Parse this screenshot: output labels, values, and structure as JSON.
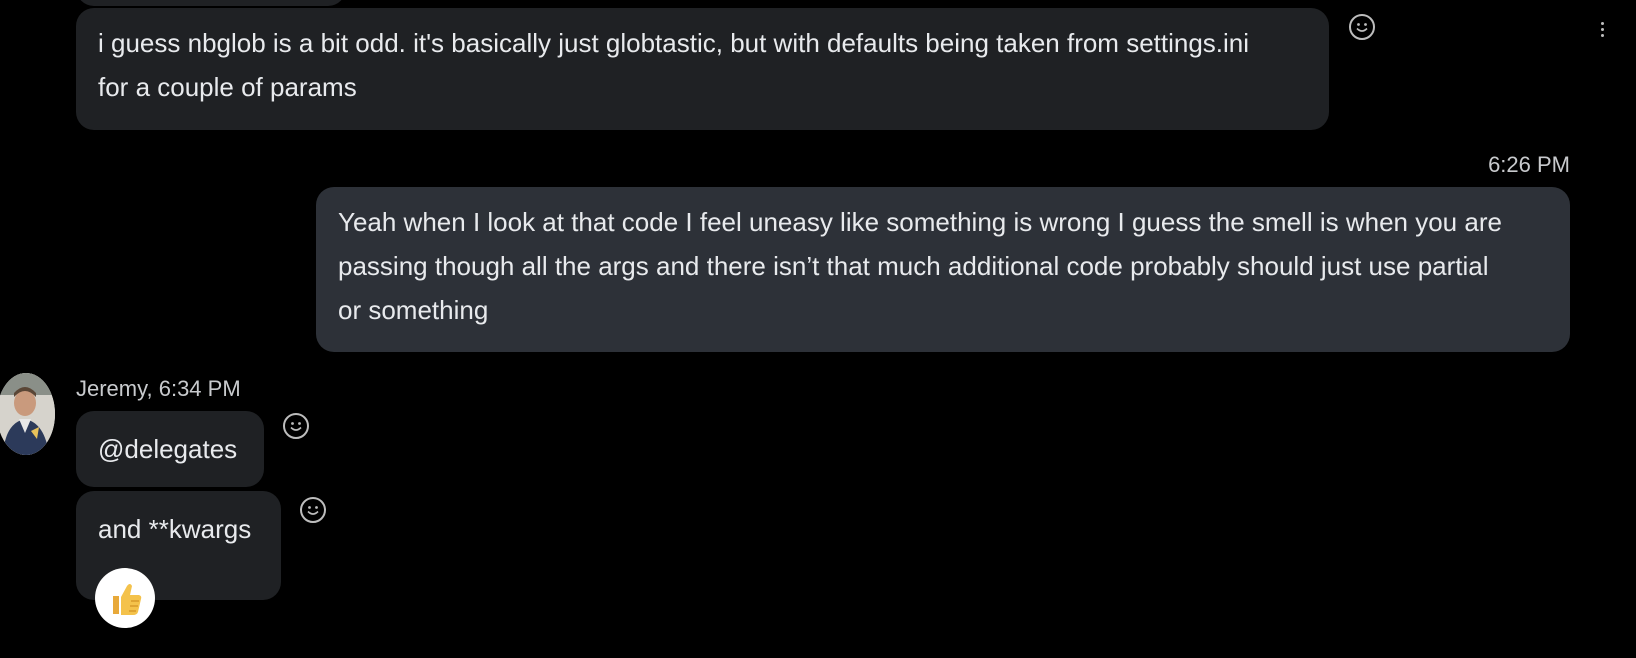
{
  "colors": {
    "background": "#000000",
    "incoming_bubble": "#1f2124",
    "outgoing_bubble": "#2d3138",
    "text": "#e8eaed",
    "meta_text": "#c8cacd",
    "icon": "#bdbdbd"
  },
  "messages": [
    {
      "direction": "incoming",
      "lines": [
        "i guess nbglob is a bit odd. it's basically just globtastic, but with defaults being taken from settings.ini",
        "for a couple of params"
      ]
    },
    {
      "direction": "outgoing",
      "timestamp": "6:26 PM",
      "lines": [
        "Yeah when I look at that code I feel uneasy like something is wrong I guess the smell is when you are",
        "passing though all the args and there isn’t that much additional code probably should just use partial",
        "or something"
      ]
    },
    {
      "direction": "incoming",
      "sender_line": "Jeremy, 6:34 PM",
      "lines": [
        "@delegates"
      ]
    },
    {
      "direction": "incoming",
      "lines": [
        "and **kwargs"
      ],
      "reaction": "thumbs-up"
    }
  ],
  "icons": {
    "add_reaction": "smiley-face-icon",
    "more": "more-options-icon",
    "reaction": "thumbs-up-icon",
    "avatar": "avatar"
  }
}
